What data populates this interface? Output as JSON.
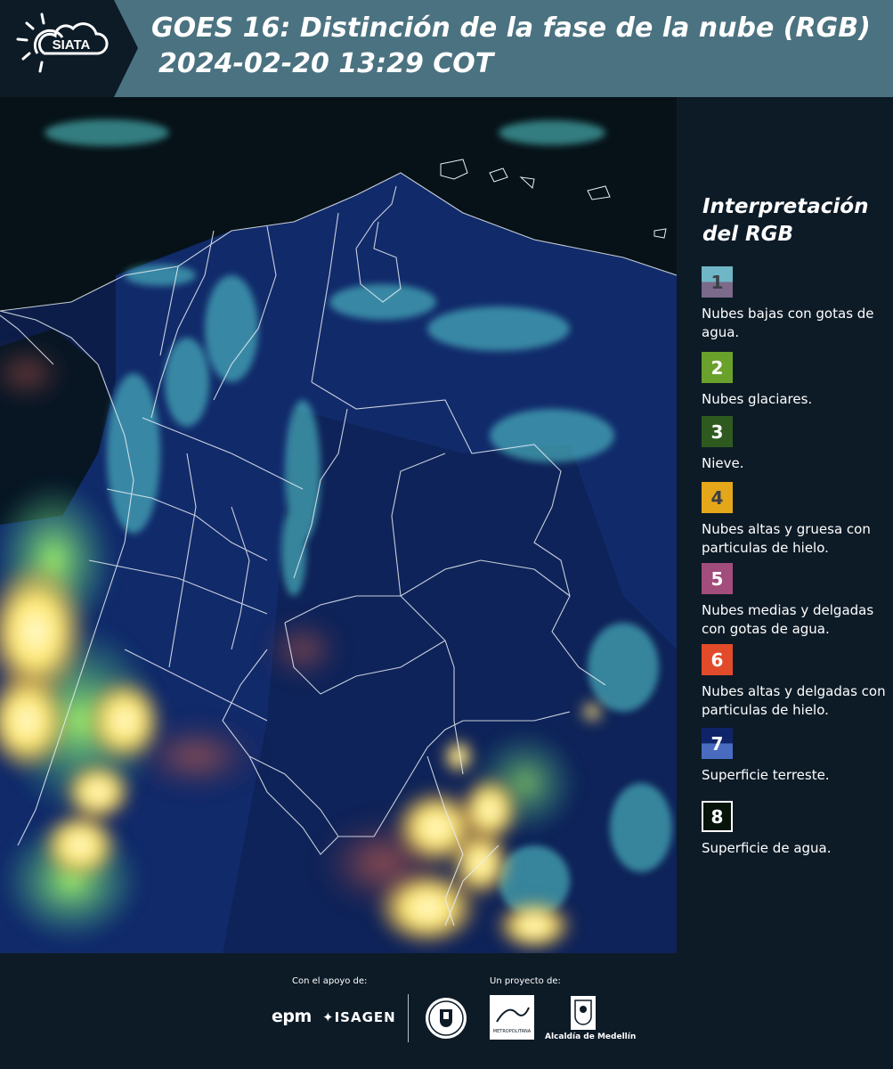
{
  "header": {
    "logo_text": "SIATA",
    "title_line1": "GOES 16: Distinción de la fase de la nube (RGB)",
    "title_line2": "2024-02-20 13:29 COT",
    "colors": {
      "banner": "#4b7280",
      "logo_bg": "#0d1b27"
    }
  },
  "legend": {
    "title": "Interpretación del RGB",
    "items": [
      {
        "num": "1",
        "label": "Nubes bajas con gotas de agua.",
        "color_top": "#6fb6c6",
        "color_bottom": "#7b6a8a"
      },
      {
        "num": "2",
        "label": "Nubes glaciares.",
        "color_top": "#6aa12b",
        "color_bottom": "#6aa12b"
      },
      {
        "num": "3",
        "label": "Nieve.",
        "color_top": "#2e5a1f",
        "color_bottom": "#2e5a1f"
      },
      {
        "num": "4",
        "label": "Nubes altas y gruesa con particulas de hielo.",
        "color_top": "#e5a71a",
        "color_bottom": "#e5a71a"
      },
      {
        "num": "5",
        "label": "Nubes medias y delgadas con gotas de agua.",
        "color_top": "#a24d7c",
        "color_bottom": "#a24d7c"
      },
      {
        "num": "6",
        "label": "Nubes altas y delgadas con particulas de hielo.",
        "color_top": "#e24b2a",
        "color_bottom": "#e24b2a"
      },
      {
        "num": "7",
        "label": "Superficie terreste.",
        "color_top": "#0f2468",
        "color_bottom": "#4a6cc0"
      },
      {
        "num": "8",
        "label": "Superficie de agua.",
        "color_top": "#071409",
        "color_bottom": "#071409"
      }
    ]
  },
  "footer": {
    "support_label": "Con el apoyo de:",
    "project_label": "Un proyecto de:",
    "sponsor1": "epm",
    "sponsor2": "ISAGEN",
    "metro_text": "METROPOLITANA",
    "alcaldia": "Alcaldía de Medellín"
  }
}
